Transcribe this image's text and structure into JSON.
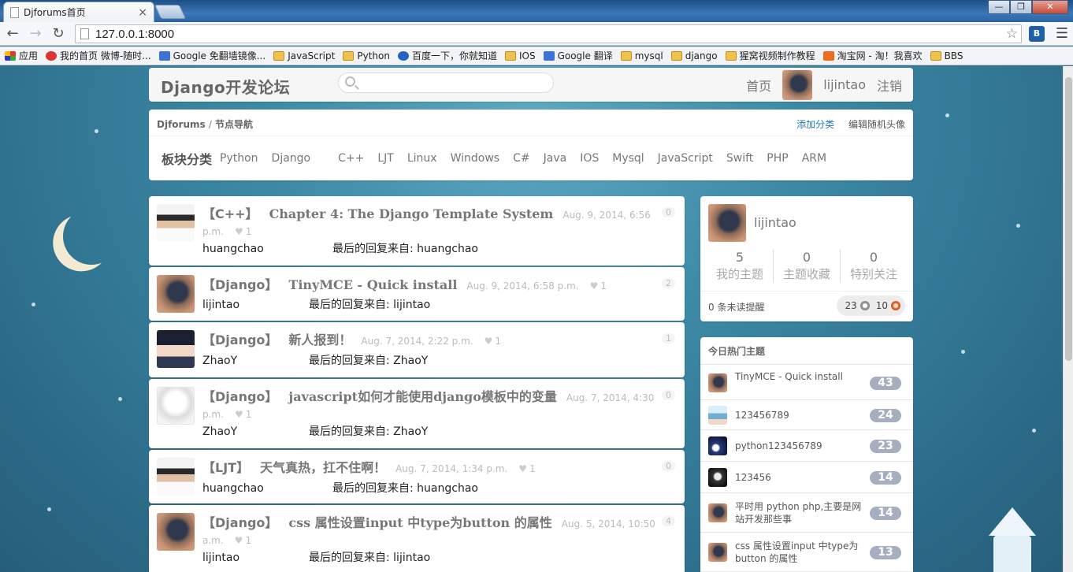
{
  "browser": {
    "tab_title": "Djforums首页",
    "tab_close": "×",
    "url": "127.0.0.1:8000",
    "window_buttons": [
      "—",
      "❐",
      "✕"
    ],
    "bookmarks": [
      {
        "label": "应用",
        "icon": "apps-icon"
      },
      {
        "label": "我的首页 微博-随时...",
        "icon": "weibo-icon"
      },
      {
        "label": "Google 免翻墙镜像...",
        "icon": "google-icon"
      },
      {
        "label": "JavaScript",
        "icon": "folder-icon"
      },
      {
        "label": "Python",
        "icon": "folder-icon"
      },
      {
        "label": "百度一下，你就知道",
        "icon": "baidu-icon"
      },
      {
        "label": "IOS",
        "icon": "folder-icon"
      },
      {
        "label": "Google 翻译",
        "icon": "translate-icon"
      },
      {
        "label": "mysql",
        "icon": "folder-icon"
      },
      {
        "label": "django",
        "icon": "folder-icon"
      },
      {
        "label": "猩窝视频制作教程",
        "icon": "folder-icon"
      },
      {
        "label": "淘宝网 - 淘！我喜欢",
        "icon": "taobao-icon"
      },
      {
        "label": "BBS",
        "icon": "folder-icon"
      }
    ]
  },
  "header": {
    "brand": "Django开发论坛",
    "search_placeholder": "",
    "nav": {
      "home": "首页",
      "username": "lijintao",
      "logout": "注销"
    }
  },
  "nodes": {
    "breadcrumb_site": "Djforums",
    "breadcrumb_sep": "/",
    "breadcrumb_page": "节点导航",
    "add_category": "添加分类",
    "edit_avatar": "编辑随机头像",
    "section_title": "板块分类",
    "items": [
      "Python",
      "Django",
      "C++",
      "LJT",
      "Linux",
      "Windows",
      "C#",
      "Java",
      "IOS",
      "Mysql",
      "JavaScript",
      "Swift",
      "PHP",
      "ARM"
    ]
  },
  "topics": [
    {
      "node": "【C++】",
      "title": "Chapter 4: The Django Template System",
      "date": "Aug. 9, 2014, 6:56 p.m.",
      "likes": "1",
      "author": "huangchao",
      "last_reply": "最后的回复来自: huangchao",
      "count": "0",
      "avatar": "man"
    },
    {
      "node": "【Django】",
      "title": "TinyMCE - Quick install",
      "date": "Aug. 9, 2014, 6:58 p.m.",
      "likes": "1",
      "author": "lijintao",
      "last_reply": "最后的回复来自: lijintao",
      "count": "2",
      "avatar": "cat"
    },
    {
      "node": "【Django】",
      "title": "新人报到！",
      "date": "Aug. 7, 2014, 2:22 p.m.",
      "likes": "1",
      "author": "ZhaoY",
      "last_reply": "最后的回复来自: ZhaoY",
      "count": "1",
      "avatar": "anime"
    },
    {
      "node": "【Django】",
      "title": "javascript如何才能使用django模板中的变量",
      "date": "Aug. 7, 2014, 4:30 p.m.",
      "likes": "1",
      "author": "ZhaoY",
      "last_reply": "最后的回复来自: ZhaoY",
      "count": "0",
      "avatar": "sketch"
    },
    {
      "node": "【LJT】",
      "title": "天气真热，扛不住啊！",
      "date": "Aug. 7, 2014, 1:34 p.m.",
      "likes": "1",
      "author": "huangchao",
      "last_reply": "最后的回复来自: huangchao",
      "count": "0",
      "avatar": "man"
    },
    {
      "node": "【Django】",
      "title": "css 属性设置input 中type为button 的属性",
      "date": "Aug. 5, 2014, 10:50 a.m.",
      "likes": "1",
      "author": "lijintao",
      "last_reply": "最后的回复来自: lijintao",
      "count": "4",
      "avatar": "cat"
    }
  ],
  "profile": {
    "name": "lijintao",
    "stats": [
      {
        "num": "5",
        "label": "我的主题"
      },
      {
        "num": "0",
        "label": "主题收藏"
      },
      {
        "num": "0",
        "label": "特别关注"
      }
    ],
    "unread": "0 条未读提醒",
    "silver": "23",
    "bronze": "10"
  },
  "hot": {
    "title": "今日热门主题",
    "items": [
      {
        "text": "TinyMCE - Quick install",
        "count": "43",
        "avatar": "cat"
      },
      {
        "text": "123456789",
        "count": "24",
        "avatar": "blue"
      },
      {
        "text": "python123456789",
        "count": "23",
        "avatar": "night"
      },
      {
        "text": "123456",
        "count": "14",
        "avatar": "dark"
      },
      {
        "text": "平时用 python php,主要是网站开发那些事",
        "count": "14",
        "avatar": "cat"
      },
      {
        "text": "css 属性设置input 中type为button 的属性",
        "count": "13",
        "avatar": "cat"
      }
    ]
  }
}
